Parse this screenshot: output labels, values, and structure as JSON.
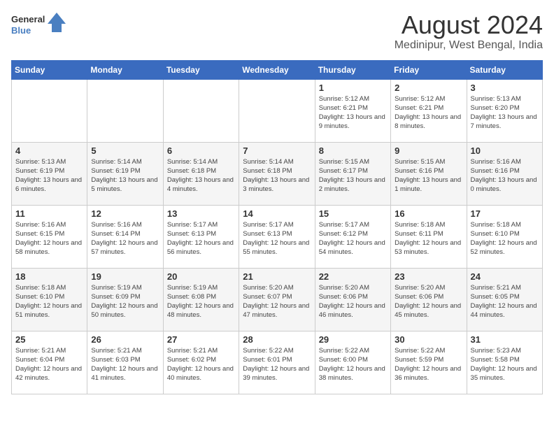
{
  "logo": {
    "line1": "General",
    "line2": "Blue"
  },
  "title": "August 2024",
  "subtitle": "Medinipur, West Bengal, India",
  "days_of_week": [
    "Sunday",
    "Monday",
    "Tuesday",
    "Wednesday",
    "Thursday",
    "Friday",
    "Saturday"
  ],
  "weeks": [
    {
      "cells": [
        {
          "empty": true
        },
        {
          "empty": true
        },
        {
          "empty": true
        },
        {
          "empty": true
        },
        {
          "day": 1,
          "sunrise": "5:12 AM",
          "sunset": "6:21 PM",
          "daylight": "13 hours and 9 minutes."
        },
        {
          "day": 2,
          "sunrise": "5:12 AM",
          "sunset": "6:21 PM",
          "daylight": "13 hours and 8 minutes."
        },
        {
          "day": 3,
          "sunrise": "5:13 AM",
          "sunset": "6:20 PM",
          "daylight": "13 hours and 7 minutes."
        }
      ]
    },
    {
      "cells": [
        {
          "day": 4,
          "sunrise": "5:13 AM",
          "sunset": "6:19 PM",
          "daylight": "13 hours and 6 minutes."
        },
        {
          "day": 5,
          "sunrise": "5:14 AM",
          "sunset": "6:19 PM",
          "daylight": "13 hours and 5 minutes."
        },
        {
          "day": 6,
          "sunrise": "5:14 AM",
          "sunset": "6:18 PM",
          "daylight": "13 hours and 4 minutes."
        },
        {
          "day": 7,
          "sunrise": "5:14 AM",
          "sunset": "6:18 PM",
          "daylight": "13 hours and 3 minutes."
        },
        {
          "day": 8,
          "sunrise": "5:15 AM",
          "sunset": "6:17 PM",
          "daylight": "13 hours and 2 minutes."
        },
        {
          "day": 9,
          "sunrise": "5:15 AM",
          "sunset": "6:16 PM",
          "daylight": "13 hours and 1 minute."
        },
        {
          "day": 10,
          "sunrise": "5:16 AM",
          "sunset": "6:16 PM",
          "daylight": "13 hours and 0 minutes."
        }
      ]
    },
    {
      "cells": [
        {
          "day": 11,
          "sunrise": "5:16 AM",
          "sunset": "6:15 PM",
          "daylight": "12 hours and 58 minutes."
        },
        {
          "day": 12,
          "sunrise": "5:16 AM",
          "sunset": "6:14 PM",
          "daylight": "12 hours and 57 minutes."
        },
        {
          "day": 13,
          "sunrise": "5:17 AM",
          "sunset": "6:13 PM",
          "daylight": "12 hours and 56 minutes."
        },
        {
          "day": 14,
          "sunrise": "5:17 AM",
          "sunset": "6:13 PM",
          "daylight": "12 hours and 55 minutes."
        },
        {
          "day": 15,
          "sunrise": "5:17 AM",
          "sunset": "6:12 PM",
          "daylight": "12 hours and 54 minutes."
        },
        {
          "day": 16,
          "sunrise": "5:18 AM",
          "sunset": "6:11 PM",
          "daylight": "12 hours and 53 minutes."
        },
        {
          "day": 17,
          "sunrise": "5:18 AM",
          "sunset": "6:10 PM",
          "daylight": "12 hours and 52 minutes."
        }
      ]
    },
    {
      "cells": [
        {
          "day": 18,
          "sunrise": "5:18 AM",
          "sunset": "6:10 PM",
          "daylight": "12 hours and 51 minutes."
        },
        {
          "day": 19,
          "sunrise": "5:19 AM",
          "sunset": "6:09 PM",
          "daylight": "12 hours and 50 minutes."
        },
        {
          "day": 20,
          "sunrise": "5:19 AM",
          "sunset": "6:08 PM",
          "daylight": "12 hours and 48 minutes."
        },
        {
          "day": 21,
          "sunrise": "5:20 AM",
          "sunset": "6:07 PM",
          "daylight": "12 hours and 47 minutes."
        },
        {
          "day": 22,
          "sunrise": "5:20 AM",
          "sunset": "6:06 PM",
          "daylight": "12 hours and 46 minutes."
        },
        {
          "day": 23,
          "sunrise": "5:20 AM",
          "sunset": "6:06 PM",
          "daylight": "12 hours and 45 minutes."
        },
        {
          "day": 24,
          "sunrise": "5:21 AM",
          "sunset": "6:05 PM",
          "daylight": "12 hours and 44 minutes."
        }
      ]
    },
    {
      "cells": [
        {
          "day": 25,
          "sunrise": "5:21 AM",
          "sunset": "6:04 PM",
          "daylight": "12 hours and 42 minutes."
        },
        {
          "day": 26,
          "sunrise": "5:21 AM",
          "sunset": "6:03 PM",
          "daylight": "12 hours and 41 minutes."
        },
        {
          "day": 27,
          "sunrise": "5:21 AM",
          "sunset": "6:02 PM",
          "daylight": "12 hours and 40 minutes."
        },
        {
          "day": 28,
          "sunrise": "5:22 AM",
          "sunset": "6:01 PM",
          "daylight": "12 hours and 39 minutes."
        },
        {
          "day": 29,
          "sunrise": "5:22 AM",
          "sunset": "6:00 PM",
          "daylight": "12 hours and 38 minutes."
        },
        {
          "day": 30,
          "sunrise": "5:22 AM",
          "sunset": "5:59 PM",
          "daylight": "12 hours and 36 minutes."
        },
        {
          "day": 31,
          "sunrise": "5:23 AM",
          "sunset": "5:58 PM",
          "daylight": "12 hours and 35 minutes."
        }
      ]
    }
  ],
  "labels": {
    "sunrise_prefix": "Sunrise:",
    "sunset_prefix": "Sunset:",
    "daylight_prefix": "Daylight:"
  }
}
